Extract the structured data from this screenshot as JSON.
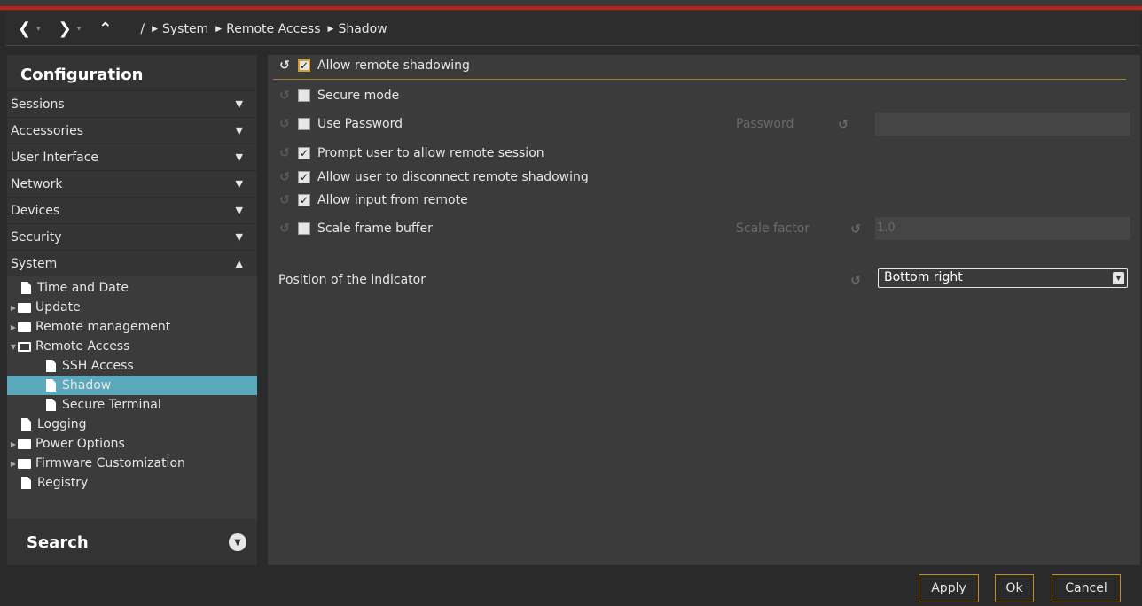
{
  "breadcrumb": {
    "root": "/",
    "items": [
      "System",
      "Remote Access",
      "Shadow"
    ]
  },
  "sidebar": {
    "title": "Configuration",
    "sections": [
      {
        "label": "Sessions",
        "expanded": false
      },
      {
        "label": "Accessories",
        "expanded": false
      },
      {
        "label": "User Interface",
        "expanded": false
      },
      {
        "label": "Network",
        "expanded": false
      },
      {
        "label": "Devices",
        "expanded": false
      },
      {
        "label": "Security",
        "expanded": false
      },
      {
        "label": "System",
        "expanded": true
      }
    ],
    "tree": [
      {
        "label": "Time and Date",
        "type": "doc",
        "level": 0
      },
      {
        "label": "Update",
        "type": "folder",
        "level": 0
      },
      {
        "label": "Remote management",
        "type": "folder",
        "level": 0
      },
      {
        "label": "Remote Access",
        "type": "folder-open",
        "level": 0
      },
      {
        "label": "SSH Access",
        "type": "doc",
        "level": 1
      },
      {
        "label": "Shadow",
        "type": "doc",
        "level": 1,
        "selected": true
      },
      {
        "label": "Secure Terminal",
        "type": "doc",
        "level": 1
      },
      {
        "label": "Logging",
        "type": "doc",
        "level": 0
      },
      {
        "label": "Power Options",
        "type": "folder",
        "level": 0
      },
      {
        "label": "Firmware Customization",
        "type": "folder",
        "level": 0
      },
      {
        "label": "Registry",
        "type": "doc",
        "level": 0
      }
    ],
    "search_label": "Search"
  },
  "settings": {
    "allow_shadowing": {
      "label": "Allow remote shadowing",
      "checked": true
    },
    "secure_mode": {
      "label": "Secure mode",
      "checked": false
    },
    "use_password": {
      "label": "Use Password",
      "checked": false
    },
    "password_label": "Password",
    "password_value": "",
    "prompt_user": {
      "label": "Prompt user to allow remote session",
      "checked": true
    },
    "allow_disconnect": {
      "label": "Allow user to disconnect remote shadowing",
      "checked": true
    },
    "allow_input": {
      "label": "Allow input from remote",
      "checked": true
    },
    "scale_fb": {
      "label": "Scale frame buffer",
      "checked": false
    },
    "scale_factor_label": "Scale factor",
    "scale_factor_value": "1.0",
    "indicator_label": "Position of the indicator",
    "indicator_value": "Bottom right"
  },
  "footer": {
    "apply": "Apply",
    "ok": "Ok",
    "cancel": "Cancel"
  },
  "colors": {
    "accent": "#c58a1e",
    "selection": "#5aa9bd",
    "alert": "#c0201a"
  }
}
